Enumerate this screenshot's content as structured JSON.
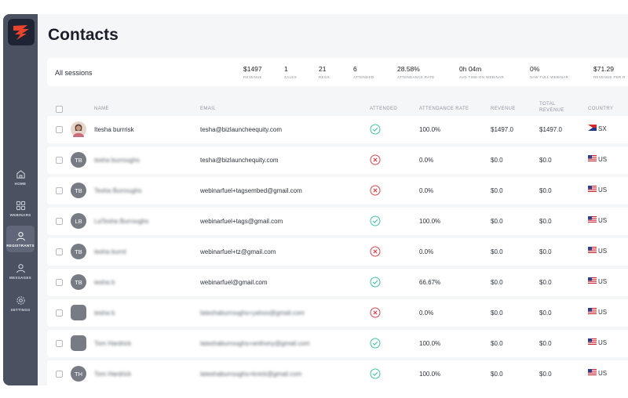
{
  "sidebar": {
    "items": [
      {
        "label": "HOME",
        "icon": "home-icon"
      },
      {
        "label": "WEBINARS",
        "icon": "grid-icon"
      },
      {
        "label": "REGISTRANTS",
        "icon": "user-icon",
        "active": true
      },
      {
        "label": "MESSAGES",
        "icon": "message-user-icon"
      },
      {
        "label": "SETTINGS",
        "icon": "gear-icon"
      }
    ]
  },
  "page": {
    "title": "Contacts"
  },
  "summary": {
    "label": "All sessions",
    "stats": [
      {
        "value": "$1497",
        "label": "REVENUE"
      },
      {
        "value": "1",
        "label": "SALES"
      },
      {
        "value": "21",
        "label": "REGS."
      },
      {
        "value": "6",
        "label": "ATTENDED"
      },
      {
        "value": "28.58%",
        "label": "ATTENDANCE RATE"
      },
      {
        "value": "0h 04m",
        "label": "AVG TIME ON WEBINAR"
      },
      {
        "value": "0%",
        "label": "SAW FULL WEBINAR"
      },
      {
        "value": "$71.29",
        "label": "REVENUE PER R"
      }
    ]
  },
  "table": {
    "headers": {
      "name": "NAME",
      "email": "EMAIL",
      "attended": "ATTENDED",
      "rate": "ATTENDANCE RATE",
      "revenue": "REVENUE",
      "total_revenue_1": "TOTAL",
      "total_revenue_2": "REVENUE",
      "country": "COUNTRY"
    },
    "rows": [
      {
        "initials": "",
        "photo": true,
        "name": "Itesha burrrisk",
        "email": "tesha@bizlauncheequity.com",
        "attended": true,
        "rate": "100.0%",
        "revenue": "$1497.0",
        "total": "$1497.0",
        "country": "SX"
      },
      {
        "initials": "TB",
        "name": "tesha burroughs",
        "email": "tesha@bizlaunchequity.com",
        "attended": false,
        "rate": "0.0%",
        "revenue": "$0.0",
        "total": "$0.0",
        "country": "US"
      },
      {
        "initials": "TB",
        "name": "Tesha Burroughs",
        "email": "webinarfuel+tagsembed@gmail.com",
        "attended": false,
        "rate": "0.0%",
        "revenue": "$0.0",
        "total": "$0.0",
        "country": "US"
      },
      {
        "initials": "LB",
        "name": "LaTesha Burroughs",
        "email": "webinarfuel+tags@gmail.com",
        "attended": true,
        "rate": "100.0%",
        "revenue": "$0.0",
        "total": "$0.0",
        "country": "US"
      },
      {
        "initials": "TB",
        "name": "tesha burrd",
        "email": "webinarfuel+tz@gmail.com",
        "attended": false,
        "rate": "0.0%",
        "revenue": "$0.0",
        "total": "$0.0",
        "country": "US"
      },
      {
        "initials": "TB",
        "name": "tesha b",
        "email": "webinarfuel@gmail.com",
        "attended": true,
        "rate": "66.67%",
        "revenue": "$0.0",
        "total": "$0.0",
        "country": "US"
      },
      {
        "initials": "",
        "square": true,
        "name": "tesha b",
        "email": "lateshaburroughs+yahoo@gmail.com",
        "attended": false,
        "rate": "0.0%",
        "revenue": "$0.0",
        "total": "$0.0",
        "country": "US"
      },
      {
        "initials": "",
        "square": true,
        "name": "Tom Hardrick",
        "email": "lateshaburroughs+anthony@gmail.com",
        "attended": true,
        "rate": "100.0%",
        "revenue": "$0.0",
        "total": "$0.0",
        "country": "US"
      },
      {
        "initials": "TH",
        "name": "Tom Hardrick",
        "email": "lateshaburroughs+knick@gmail.com",
        "attended": true,
        "rate": "100.0%",
        "revenue": "$0.0",
        "total": "$0.0",
        "country": "US"
      }
    ]
  },
  "colors": {
    "sidebar": "#4a5262",
    "logo_bg": "#1e2433",
    "logo_flame": "#e8442b",
    "check": "#3cc3a8",
    "cross": "#e0434b"
  }
}
